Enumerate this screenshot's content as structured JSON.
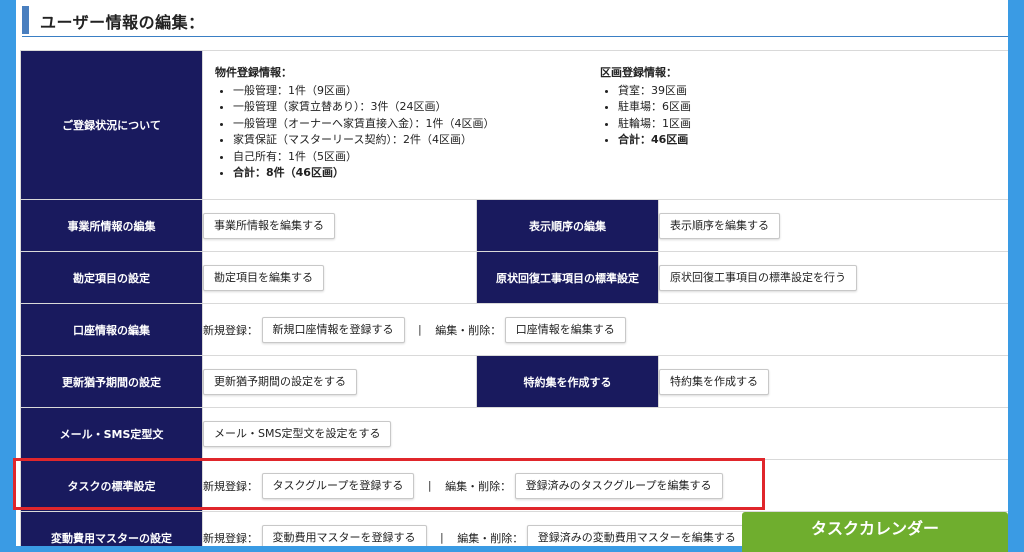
{
  "page_title": "ユーザー情報の編集：",
  "registration": {
    "header": "ご登録状況について",
    "property": {
      "title": "物件登録情報：",
      "items": [
        "一般管理：1件（9区画）",
        "一般管理（家賃立替あり）：3件（24区画）",
        "一般管理（オーナーへ家賃直接入金）：1件（4区画）",
        "家賃保証（マスターリース契約）：2件（4区画）",
        "自己所有：1件（5区画）"
      ],
      "total": "合計：8件（46区画）"
    },
    "section": {
      "title": "区画登録情報：",
      "items": [
        "貸室：39区画",
        "駐車場：6区画",
        "駐輪場：1区画"
      ],
      "total": "合計：46区画"
    }
  },
  "rows": {
    "office": {
      "header": "事業所情報の編集",
      "button": "事業所情報を編集する"
    },
    "display_order": {
      "header": "表示順序の編集",
      "button": "表示順序を編集する"
    },
    "account_items": {
      "header": "勘定項目の設定",
      "button": "勘定項目を編集する"
    },
    "restoration": {
      "header": "原状回復工事項目の標準設定",
      "button": "原状回復工事項目の標準設定を行う"
    },
    "bank": {
      "header": "口座情報の編集",
      "new_label": "新規登録：",
      "new_button": "新規口座情報を登録する",
      "separator": "|",
      "edit_label": "編集・削除：",
      "edit_button": "口座情報を編集する"
    },
    "renewal": {
      "header": "更新猶予期間の設定",
      "button": "更新猶予期間の設定をする"
    },
    "special_terms": {
      "header": "特約集を作成する",
      "button": "特約集を作成する"
    },
    "mail_sms": {
      "header": "メール・SMS定型文",
      "button": "メール・SMS定型文を設定をする"
    },
    "task": {
      "header": "タスクの標準設定",
      "new_label": "新規登録：",
      "new_button": "タスクグループを登録する",
      "separator": "|",
      "edit_label": "編集・削除：",
      "edit_button": "登録済みのタスクグループを編集する"
    },
    "variable_cost": {
      "header": "変動費用マスターの設定",
      "new_label": "新規登録：",
      "new_button": "変動費用マスターを登録する",
      "separator": "|",
      "edit_label": "編集・削除：",
      "edit_button": "登録済みの変動費用マスターを編集する"
    }
  },
  "task_calendar_button": "タスクカレンダー",
  "colors": {
    "header_bg": "#191a5e",
    "page_bg": "#3a9be4",
    "highlight": "#e0262b",
    "calendar_button": "#6fae2e"
  }
}
